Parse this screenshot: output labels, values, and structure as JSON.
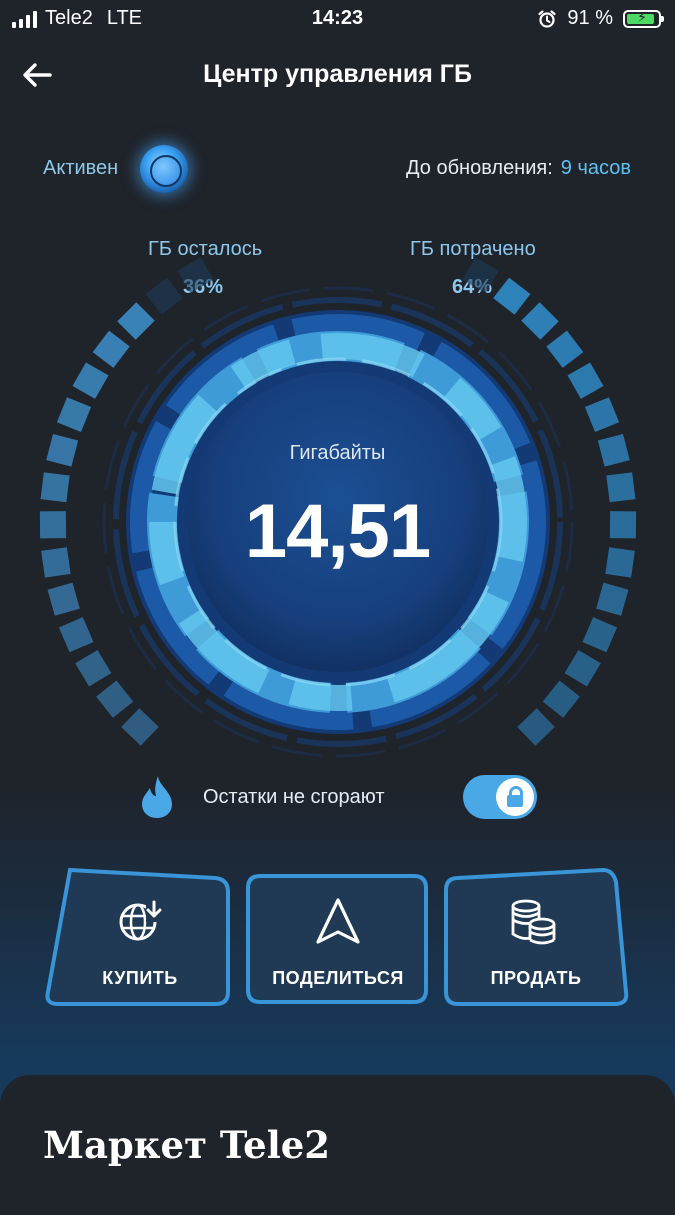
{
  "status_bar": {
    "carrier": "Tele2",
    "network": "LTE",
    "time": "14:23",
    "battery_percent": "91 %",
    "battery_level": 0.91,
    "alarm_icon": "alarm-clock-icon",
    "battery_icon": "battery-charging-icon"
  },
  "header": {
    "title": "Центр управления ГБ",
    "back_icon": "arrow-left-icon"
  },
  "status": {
    "active_label": "Активен",
    "update_label": "До обновления:",
    "update_value": "9 часов"
  },
  "gauge": {
    "remaining_label": "ГБ осталось",
    "remaining_percent": "36%",
    "spent_label": "ГБ потрачено",
    "spent_percent": "64%",
    "center_label": "Гигабайты",
    "center_value": "14,51",
    "remaining_fraction": 0.36,
    "spent_fraction": 0.64
  },
  "rollover": {
    "label": "Остатки не сгорают",
    "toggle_on": true,
    "icon": "flame-icon"
  },
  "actions": [
    {
      "label": "КУПИТЬ",
      "icon": "globe-download-icon"
    },
    {
      "label": "ПОДЕЛИТЬСЯ",
      "icon": "navigation-arrow-icon"
    },
    {
      "label": "ПРОДАТЬ",
      "icon": "coins-stack-icon"
    }
  ],
  "market": {
    "title": "Маркет Tele2"
  },
  "colors": {
    "background": "#1f232a",
    "accent": "#4aa8e6",
    "accent_light": "#5ec3f2",
    "ring_dark": "#1a4a8a"
  }
}
